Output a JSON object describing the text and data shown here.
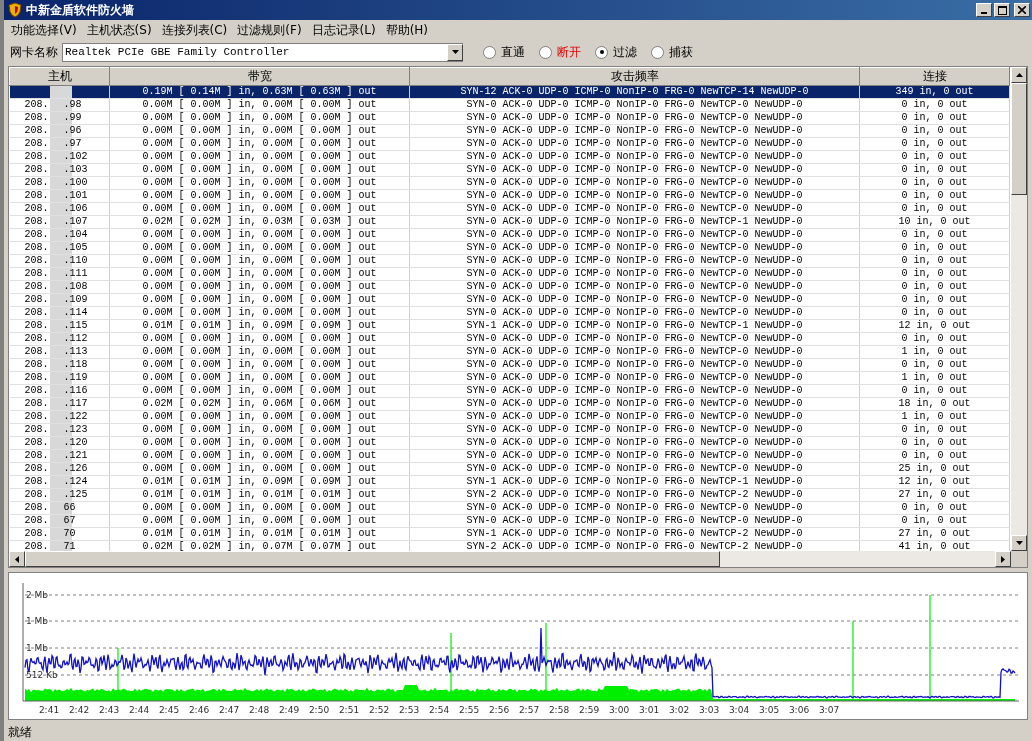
{
  "window": {
    "title": "中新金盾软件防火墙"
  },
  "menu": [
    "功能选择(V)",
    "主机状态(S)",
    "连接列表(C)",
    "过滤规则(F)",
    "日志记录(L)",
    "帮助(H)"
  ],
  "toolbar": {
    "adapter_label": "网卡名称",
    "adapter_value": "Realtek PCIe GBE Family Controller",
    "modes": [
      {
        "label": "直通",
        "selected": false,
        "highlighted": false
      },
      {
        "label": "断开",
        "selected": false,
        "highlighted": true
      },
      {
        "label": "过滤",
        "selected": true,
        "highlighted": false
      },
      {
        "label": "捕获",
        "selected": false,
        "highlighted": false
      }
    ]
  },
  "table": {
    "columns": [
      "主机",
      "带宽",
      "攻击频率",
      "连接"
    ],
    "rows": [
      {
        "selected": true,
        "bandwidth": "0.19M [ 0.14M ] in, 0.63M [ 0.63M ] out",
        "attacks": "SYN-12 ACK-0 UDP-0 ICMP-0 NonIP-0 FRG-0 NewTCP-14 NewUDP-0",
        "connections": "349 in, 0 out"
      },
      {
        "selected": false,
        "host_prefix": "208.",
        "host_suffix": ".98",
        "bandwidth": "0.00M [ 0.00M ] in, 0.00M [ 0.00M ] out",
        "attacks": "SYN-0 ACK-0 UDP-0 ICMP-0 NonIP-0 FRG-0 NewTCP-0 NewUDP-0",
        "connections": "0 in, 0 out"
      },
      {
        "selected": false,
        "host_prefix": "208.",
        "host_suffix": ".99",
        "bandwidth": "0.00M [ 0.00M ] in, 0.00M [ 0.00M ] out",
        "attacks": "SYN-0 ACK-0 UDP-0 ICMP-0 NonIP-0 FRG-0 NewTCP-0 NewUDP-0",
        "connections": "0 in, 0 out"
      },
      {
        "selected": false,
        "host_prefix": "208.",
        "host_suffix": ".96",
        "bandwidth": "0.00M [ 0.00M ] in, 0.00M [ 0.00M ] out",
        "attacks": "SYN-0 ACK-0 UDP-0 ICMP-0 NonIP-0 FRG-0 NewTCP-0 NewUDP-0",
        "connections": "0 in, 0 out"
      },
      {
        "selected": false,
        "host_prefix": "208.",
        "host_suffix": ".97",
        "bandwidth": "0.00M [ 0.00M ] in, 0.00M [ 0.00M ] out",
        "attacks": "SYN-0 ACK-0 UDP-0 ICMP-0 NonIP-0 FRG-0 NewTCP-0 NewUDP-0",
        "connections": "0 in, 0 out"
      },
      {
        "selected": false,
        "host_prefix": "208.",
        "host_suffix": ".102",
        "bandwidth": "0.00M [ 0.00M ] in, 0.00M [ 0.00M ] out",
        "attacks": "SYN-0 ACK-0 UDP-0 ICMP-0 NonIP-0 FRG-0 NewTCP-0 NewUDP-0",
        "connections": "0 in, 0 out"
      },
      {
        "selected": false,
        "host_prefix": "208.",
        "host_suffix": ".103",
        "bandwidth": "0.00M [ 0.00M ] in, 0.00M [ 0.00M ] out",
        "attacks": "SYN-0 ACK-0 UDP-0 ICMP-0 NonIP-0 FRG-0 NewTCP-0 NewUDP-0",
        "connections": "0 in, 0 out"
      },
      {
        "selected": false,
        "host_prefix": "208.",
        "host_suffix": ".100",
        "bandwidth": "0.00M [ 0.00M ] in, 0.00M [ 0.00M ] out",
        "attacks": "SYN-0 ACK-0 UDP-0 ICMP-0 NonIP-0 FRG-0 NewTCP-0 NewUDP-0",
        "connections": "0 in, 0 out"
      },
      {
        "selected": false,
        "host_prefix": "208.",
        "host_suffix": ".101",
        "bandwidth": "0.00M [ 0.00M ] in, 0.00M [ 0.00M ] out",
        "attacks": "SYN-0 ACK-0 UDP-0 ICMP-0 NonIP-0 FRG-0 NewTCP-0 NewUDP-0",
        "connections": "0 in, 0 out"
      },
      {
        "selected": false,
        "host_prefix": "208.",
        "host_suffix": ".106",
        "bandwidth": "0.00M [ 0.00M ] in, 0.00M [ 0.00M ] out",
        "attacks": "SYN-0 ACK-0 UDP-0 ICMP-0 NonIP-0 FRG-0 NewTCP-0 NewUDP-0",
        "connections": "0 in, 0 out"
      },
      {
        "selected": false,
        "host_prefix": "208.",
        "host_suffix": ".107",
        "bandwidth": "0.02M [ 0.02M ] in, 0.03M [ 0.03M ] out",
        "attacks": "SYN-0 ACK-0 UDP-0 ICMP-0 NonIP-0 FRG-0 NewTCP-1 NewUDP-0",
        "connections": "10 in, 0 out"
      },
      {
        "selected": false,
        "host_prefix": "208.",
        "host_suffix": ".104",
        "bandwidth": "0.00M [ 0.00M ] in, 0.00M [ 0.00M ] out",
        "attacks": "SYN-0 ACK-0 UDP-0 ICMP-0 NonIP-0 FRG-0 NewTCP-0 NewUDP-0",
        "connections": "0 in, 0 out"
      },
      {
        "selected": false,
        "host_prefix": "208.",
        "host_suffix": ".105",
        "bandwidth": "0.00M [ 0.00M ] in, 0.00M [ 0.00M ] out",
        "attacks": "SYN-0 ACK-0 UDP-0 ICMP-0 NonIP-0 FRG-0 NewTCP-0 NewUDP-0",
        "connections": "0 in, 0 out"
      },
      {
        "selected": false,
        "host_prefix": "208.",
        "host_suffix": ".110",
        "bandwidth": "0.00M [ 0.00M ] in, 0.00M [ 0.00M ] out",
        "attacks": "SYN-0 ACK-0 UDP-0 ICMP-0 NonIP-0 FRG-0 NewTCP-0 NewUDP-0",
        "connections": "0 in, 0 out"
      },
      {
        "selected": false,
        "host_prefix": "208.",
        "host_suffix": ".111",
        "bandwidth": "0.00M [ 0.00M ] in, 0.00M [ 0.00M ] out",
        "attacks": "SYN-0 ACK-0 UDP-0 ICMP-0 NonIP-0 FRG-0 NewTCP-0 NewUDP-0",
        "connections": "0 in, 0 out"
      },
      {
        "selected": false,
        "host_prefix": "208.",
        "host_suffix": ".108",
        "bandwidth": "0.00M [ 0.00M ] in, 0.00M [ 0.00M ] out",
        "attacks": "SYN-0 ACK-0 UDP-0 ICMP-0 NonIP-0 FRG-0 NewTCP-0 NewUDP-0",
        "connections": "0 in, 0 out"
      },
      {
        "selected": false,
        "host_prefix": "208.",
        "host_suffix": ".109",
        "bandwidth": "0.00M [ 0.00M ] in, 0.00M [ 0.00M ] out",
        "attacks": "SYN-0 ACK-0 UDP-0 ICMP-0 NonIP-0 FRG-0 NewTCP-0 NewUDP-0",
        "connections": "0 in, 0 out"
      },
      {
        "selected": false,
        "host_prefix": "208.",
        "host_suffix": ".114",
        "bandwidth": "0.00M [ 0.00M ] in, 0.00M [ 0.00M ] out",
        "attacks": "SYN-0 ACK-0 UDP-0 ICMP-0 NonIP-0 FRG-0 NewTCP-0 NewUDP-0",
        "connections": "0 in, 0 out"
      },
      {
        "selected": false,
        "host_prefix": "208.",
        "host_suffix": ".115",
        "bandwidth": "0.01M [ 0.01M ] in, 0.09M [ 0.09M ] out",
        "attacks": "SYN-1 ACK-0 UDP-0 ICMP-0 NonIP-0 FRG-0 NewTCP-1 NewUDP-0",
        "connections": "12 in, 0 out"
      },
      {
        "selected": false,
        "host_prefix": "208.",
        "host_suffix": ".112",
        "bandwidth": "0.00M [ 0.00M ] in, 0.00M [ 0.00M ] out",
        "attacks": "SYN-0 ACK-0 UDP-0 ICMP-0 NonIP-0 FRG-0 NewTCP-0 NewUDP-0",
        "connections": "0 in, 0 out"
      },
      {
        "selected": false,
        "host_prefix": "208.",
        "host_suffix": ".113",
        "bandwidth": "0.00M [ 0.00M ] in, 0.00M [ 0.00M ] out",
        "attacks": "SYN-0 ACK-0 UDP-0 ICMP-0 NonIP-0 FRG-0 NewTCP-0 NewUDP-0",
        "connections": "1 in, 0 out"
      },
      {
        "selected": false,
        "host_prefix": "208.",
        "host_suffix": ".118",
        "bandwidth": "0.00M [ 0.00M ] in, 0.00M [ 0.00M ] out",
        "attacks": "SYN-0 ACK-0 UDP-0 ICMP-0 NonIP-0 FRG-0 NewTCP-0 NewUDP-0",
        "connections": "0 in, 0 out"
      },
      {
        "selected": false,
        "host_prefix": "208.",
        "host_suffix": ".119",
        "bandwidth": "0.00M [ 0.00M ] in, 0.00M [ 0.00M ] out",
        "attacks": "SYN-0 ACK-0 UDP-0 ICMP-0 NonIP-0 FRG-0 NewTCP-0 NewUDP-0",
        "connections": "1 in, 0 out"
      },
      {
        "selected": false,
        "host_prefix": "208.",
        "host_suffix": ".116",
        "bandwidth": "0.00M [ 0.00M ] in, 0.00M [ 0.00M ] out",
        "attacks": "SYN-0 ACK-0 UDP-0 ICMP-0 NonIP-0 FRG-0 NewTCP-0 NewUDP-0",
        "connections": "0 in, 0 out"
      },
      {
        "selected": false,
        "host_prefix": "208.",
        "host_suffix": ".117",
        "bandwidth": "0.02M [ 0.02M ] in, 0.06M [ 0.06M ] out",
        "attacks": "SYN-0 ACK-0 UDP-0 ICMP-0 NonIP-0 FRG-0 NewTCP-0 NewUDP-0",
        "connections": "18 in, 0 out"
      },
      {
        "selected": false,
        "host_prefix": "208.",
        "host_suffix": ".122",
        "bandwidth": "0.00M [ 0.00M ] in, 0.00M [ 0.00M ] out",
        "attacks": "SYN-0 ACK-0 UDP-0 ICMP-0 NonIP-0 FRG-0 NewTCP-0 NewUDP-0",
        "connections": "1 in, 0 out"
      },
      {
        "selected": false,
        "host_prefix": "208.",
        "host_suffix": ".123",
        "bandwidth": "0.00M [ 0.00M ] in, 0.00M [ 0.00M ] out",
        "attacks": "SYN-0 ACK-0 UDP-0 ICMP-0 NonIP-0 FRG-0 NewTCP-0 NewUDP-0",
        "connections": "0 in, 0 out"
      },
      {
        "selected": false,
        "host_prefix": "208.",
        "host_suffix": ".120",
        "bandwidth": "0.00M [ 0.00M ] in, 0.00M [ 0.00M ] out",
        "attacks": "SYN-0 ACK-0 UDP-0 ICMP-0 NonIP-0 FRG-0 NewTCP-0 NewUDP-0",
        "connections": "0 in, 0 out"
      },
      {
        "selected": false,
        "host_prefix": "208.",
        "host_suffix": ".121",
        "bandwidth": "0.00M [ 0.00M ] in, 0.00M [ 0.00M ] out",
        "attacks": "SYN-0 ACK-0 UDP-0 ICMP-0 NonIP-0 FRG-0 NewTCP-0 NewUDP-0",
        "connections": "0 in, 0 out"
      },
      {
        "selected": false,
        "host_prefix": "208.",
        "host_suffix": ".126",
        "bandwidth": "0.00M [ 0.00M ] in, 0.00M [ 0.00M ] out",
        "attacks": "SYN-0 ACK-0 UDP-0 ICMP-0 NonIP-0 FRG-0 NewTCP-0 NewUDP-0",
        "connections": "25 in, 0 out"
      },
      {
        "selected": false,
        "host_prefix": "208.",
        "host_suffix": ".124",
        "bandwidth": "0.01M [ 0.01M ] in, 0.09M [ 0.09M ] out",
        "attacks": "SYN-1 ACK-0 UDP-0 ICMP-0 NonIP-0 FRG-0 NewTCP-1 NewUDP-0",
        "connections": "12 in, 0 out"
      },
      {
        "selected": false,
        "host_prefix": "208.",
        "host_suffix": ".125",
        "bandwidth": "0.01M [ 0.01M ] in, 0.01M [ 0.01M ] out",
        "attacks": "SYN-2 ACK-0 UDP-0 ICMP-0 NonIP-0 FRG-0 NewTCP-2 NewUDP-0",
        "connections": "27 in, 0 out"
      },
      {
        "selected": false,
        "host_prefix": "208.",
        "host_suffix": "66",
        "bandwidth": "0.00M [ 0.00M ] in, 0.00M [ 0.00M ] out",
        "attacks": "SYN-0 ACK-0 UDP-0 ICMP-0 NonIP-0 FRG-0 NewTCP-0 NewUDP-0",
        "connections": "0 in, 0 out"
      },
      {
        "selected": false,
        "host_prefix": "208.",
        "host_suffix": "67",
        "bandwidth": "0.00M [ 0.00M ] in, 0.00M [ 0.00M ] out",
        "attacks": "SYN-0 ACK-0 UDP-0 ICMP-0 NonIP-0 FRG-0 NewTCP-0 NewUDP-0",
        "connections": "0 in, 0 out"
      },
      {
        "selected": false,
        "host_prefix": "208.",
        "host_suffix": "70",
        "bandwidth": "0.01M [ 0.01M ] in, 0.01M [ 0.01M ] out",
        "attacks": "SYN-1 ACK-0 UDP-0 ICMP-0 NonIP-0 FRG-0 NewTCP-2 NewUDP-0",
        "connections": "27 in, 0 out"
      },
      {
        "selected": false,
        "host_prefix": "208.",
        "host_suffix": "71",
        "bandwidth": "0.02M [ 0.02M ] in, 0.07M [ 0.07M ] out",
        "attacks": "SYN-2 ACK-0 UDP-0 ICMP-0 NonIP-0 FRG-0 NewTCP-2 NewUDP-0",
        "connections": "41 in, 0 out"
      }
    ]
  },
  "graph": {
    "y_labels": [
      "2 Mb",
      "1 Mb",
      "1 Mb",
      "512 Kb"
    ],
    "x_labels": [
      "2:41",
      "2:42",
      "2:43",
      "2:44",
      "2:45",
      "2:46",
      "2:47",
      "2:48",
      "2:49",
      "2:50",
      "2:51",
      "2:52",
      "2:53",
      "2:54",
      "2:55",
      "2:56",
      "2:57",
      "2:58",
      "2:59",
      "3:00",
      "3:01",
      "3:02",
      "3:03",
      "3:04",
      "3:05",
      "3:06",
      "3:07"
    ]
  },
  "status_bar": "就绪"
}
